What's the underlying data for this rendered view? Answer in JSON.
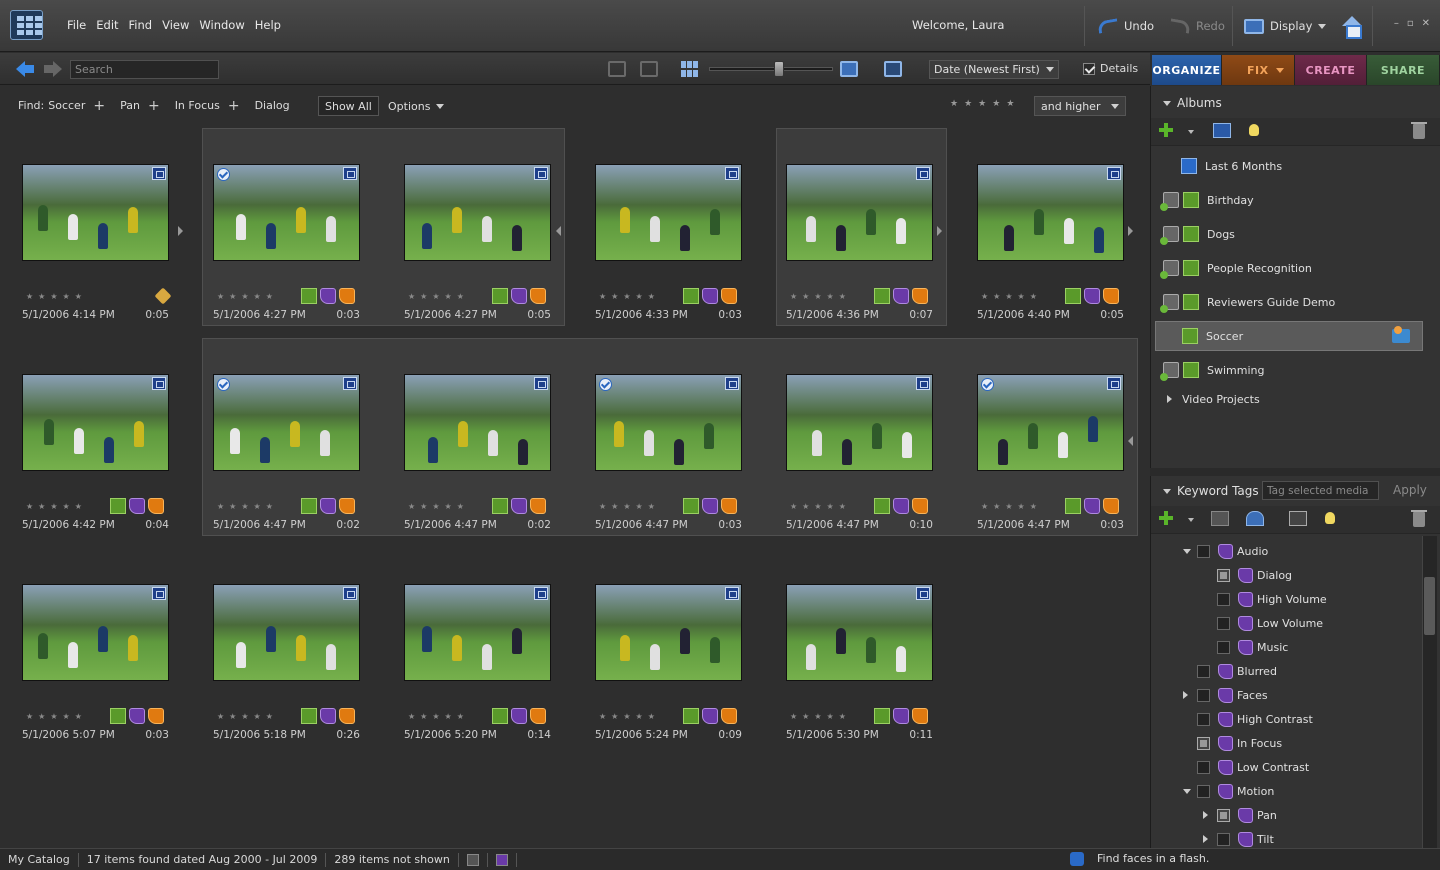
{
  "menubar": {
    "items": [
      "File",
      "Edit",
      "Find",
      "View",
      "Window",
      "Help"
    ],
    "welcome": "Welcome, Laura",
    "undo_label": "Undo",
    "redo_label": "Redo",
    "display_label": "Display"
  },
  "toolbar": {
    "search_placeholder": "Search",
    "sort_value": "Date (Newest First)",
    "details_label": "Details"
  },
  "mode_tabs": {
    "organize": "ORGANIZE",
    "fix": "FIX",
    "create": "CREATE",
    "share": "SHARE"
  },
  "find": {
    "label": "Find:",
    "terms": [
      "Soccer",
      "Pan",
      "In Focus",
      "Dialog"
    ],
    "show_all": "Show All",
    "options": "Options",
    "rating_filter": "and higher"
  },
  "media": [
    {
      "date": "5/1/2006 4:14 PM",
      "duration": "0:05"
    },
    {
      "date": "5/1/2006 4:27 PM",
      "duration": "0:03"
    },
    {
      "date": "5/1/2006 4:27 PM",
      "duration": "0:05"
    },
    {
      "date": "5/1/2006 4:33 PM",
      "duration": "0:03"
    },
    {
      "date": "5/1/2006 4:36 PM",
      "duration": "0:07"
    },
    {
      "date": "5/1/2006 4:40 PM",
      "duration": "0:05"
    },
    {
      "date": "5/1/2006 4:42 PM",
      "duration": "0:04"
    },
    {
      "date": "5/1/2006 4:47 PM",
      "duration": "0:02"
    },
    {
      "date": "5/1/2006 4:47 PM",
      "duration": "0:02"
    },
    {
      "date": "5/1/2006 4:47 PM",
      "duration": "0:03"
    },
    {
      "date": "5/1/2006 4:47 PM",
      "duration": "0:10"
    },
    {
      "date": "5/1/2006 4:47 PM",
      "duration": "0:03"
    },
    {
      "date": "5/1/2006 5:07 PM",
      "duration": "0:03"
    },
    {
      "date": "5/1/2006 5:18 PM",
      "duration": "0:26"
    },
    {
      "date": "5/1/2006 5:20 PM",
      "duration": "0:14"
    },
    {
      "date": "5/1/2006 5:24 PM",
      "duration": "0:09"
    },
    {
      "date": "5/1/2006 5:30 PM",
      "duration": "0:11"
    }
  ],
  "albums": {
    "title": "Albums",
    "items": [
      {
        "label": "Last 6 Months",
        "type": "album"
      },
      {
        "label": "Birthday",
        "type": "smart"
      },
      {
        "label": "Dogs",
        "type": "smart"
      },
      {
        "label": "People Recognition",
        "type": "smart"
      },
      {
        "label": "Reviewers Guide Demo",
        "type": "smart"
      },
      {
        "label": "Soccer",
        "type": "album"
      },
      {
        "label": "Swimming",
        "type": "smart"
      },
      {
        "label": "Video Projects",
        "type": "group"
      }
    ],
    "selected": "Soccer"
  },
  "keywords": {
    "title": "Keyword Tags",
    "input_placeholder": "Tag selected media",
    "apply": "Apply",
    "items": [
      {
        "label": "Audio",
        "level": 0
      },
      {
        "label": "Dialog",
        "level": 1
      },
      {
        "label": "High Volume",
        "level": 1
      },
      {
        "label": "Low Volume",
        "level": 1
      },
      {
        "label": "Music",
        "level": 1
      },
      {
        "label": "Blurred",
        "level": 0
      },
      {
        "label": "Faces",
        "level": 0
      },
      {
        "label": "High Contrast",
        "level": 0
      },
      {
        "label": "In Focus",
        "level": 0
      },
      {
        "label": "Low Contrast",
        "level": 0
      },
      {
        "label": "Motion",
        "level": 0
      },
      {
        "label": "Pan",
        "level": 1
      },
      {
        "label": "Tilt",
        "level": 1
      }
    ]
  },
  "status": {
    "catalog": "My Catalog",
    "found": "17 items found dated Aug 2000 - Jul 2009",
    "not_shown": "289 items not shown",
    "tip": "Find faces in a flash."
  }
}
